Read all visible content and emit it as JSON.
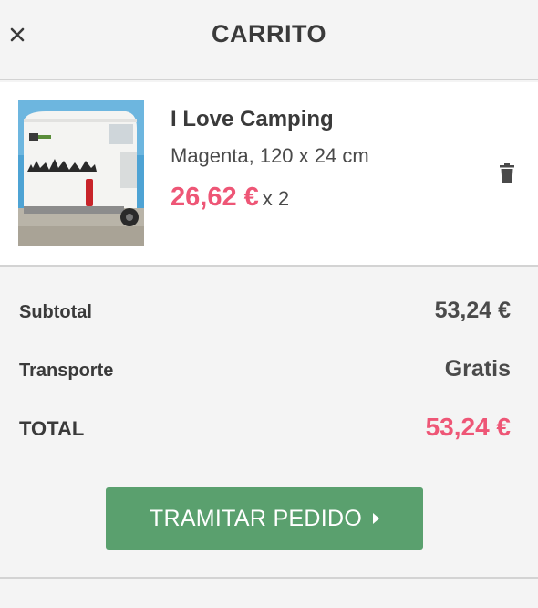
{
  "header": {
    "title": "CARRITO",
    "close_icon": "close-icon"
  },
  "item": {
    "name": "I Love Camping",
    "variant": "Magenta, 120 x 24 cm",
    "price": "26,62 €",
    "quantity": "x 2",
    "delete_icon": "trash-icon"
  },
  "summary": {
    "subtotal_label": "Subtotal",
    "subtotal_value": "53,24 €",
    "shipping_label": "Transporte",
    "shipping_value": "Gratis",
    "total_label": "TOTAL",
    "total_value": "53,24 €"
  },
  "checkout": {
    "label": "TRAMITAR PEDIDO",
    "arrow_icon": "caret-right-icon"
  },
  "colors": {
    "accent_price": "#ee5676",
    "checkout_button": "#5aa06e",
    "background": "#f4f4f4",
    "text": "#3a3a3a"
  }
}
